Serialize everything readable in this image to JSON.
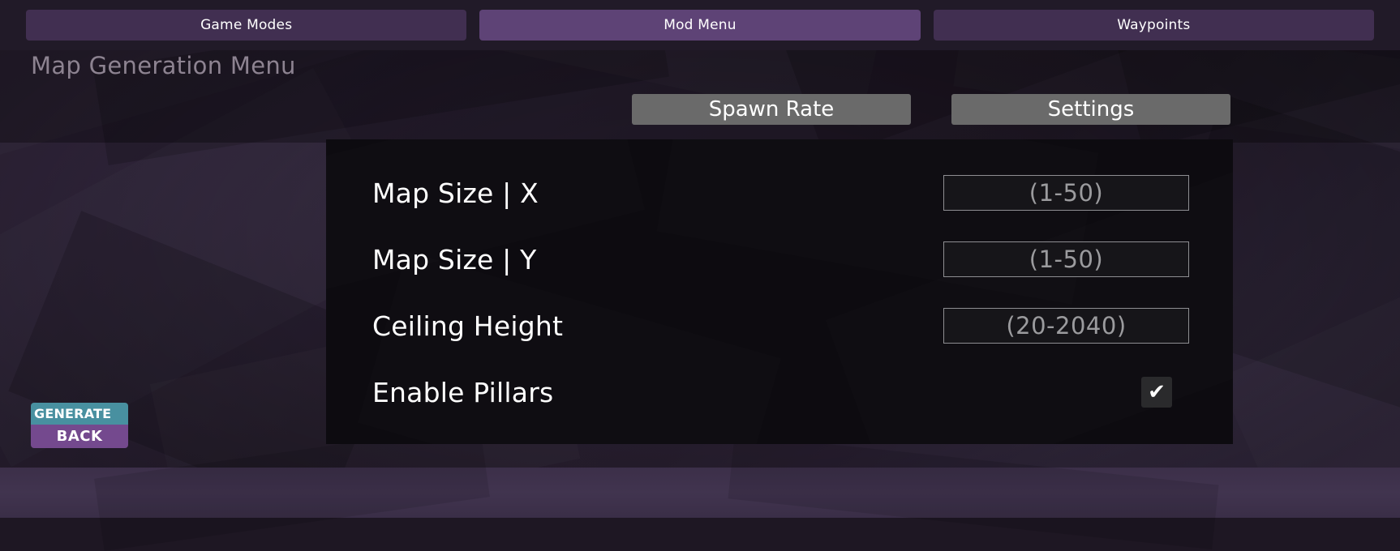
{
  "tabs": [
    {
      "label": "Game Modes",
      "active": false
    },
    {
      "label": "Mod Menu",
      "active": true
    },
    {
      "label": "Waypoints",
      "active": false
    }
  ],
  "header": {
    "title": "Map Generation Menu"
  },
  "toolbar": {
    "spawn_rate_label": "Spawn Rate",
    "settings_label": "Settings"
  },
  "panel": {
    "rows": [
      {
        "label": "Map Size | X",
        "type": "input",
        "placeholder": "(1-50)",
        "value": ""
      },
      {
        "label": "Map Size | Y",
        "type": "input",
        "placeholder": "(1-50)",
        "value": ""
      },
      {
        "label": "Ceiling Height",
        "type": "input",
        "placeholder": "(20-2040)",
        "value": ""
      },
      {
        "label": "Enable Pillars",
        "type": "checkbox",
        "checked": true,
        "mark": "✔"
      }
    ]
  },
  "actions": {
    "generate_label": "GENERATE",
    "back_label": "BACK"
  },
  "colors": {
    "tab_inactive": "#412f51",
    "tab_active": "#5e4376",
    "tab_bar": "#211a28",
    "topbutton": "#6a6a6a",
    "panel_bg": "#0d0b10",
    "field_border": "#8e8e92",
    "field_bg": "#161519",
    "placeholder_text": "#9b9b9e",
    "generate": "#4890a0",
    "back": "#74498e",
    "title_text": "#8d8391",
    "background": "#342840"
  }
}
